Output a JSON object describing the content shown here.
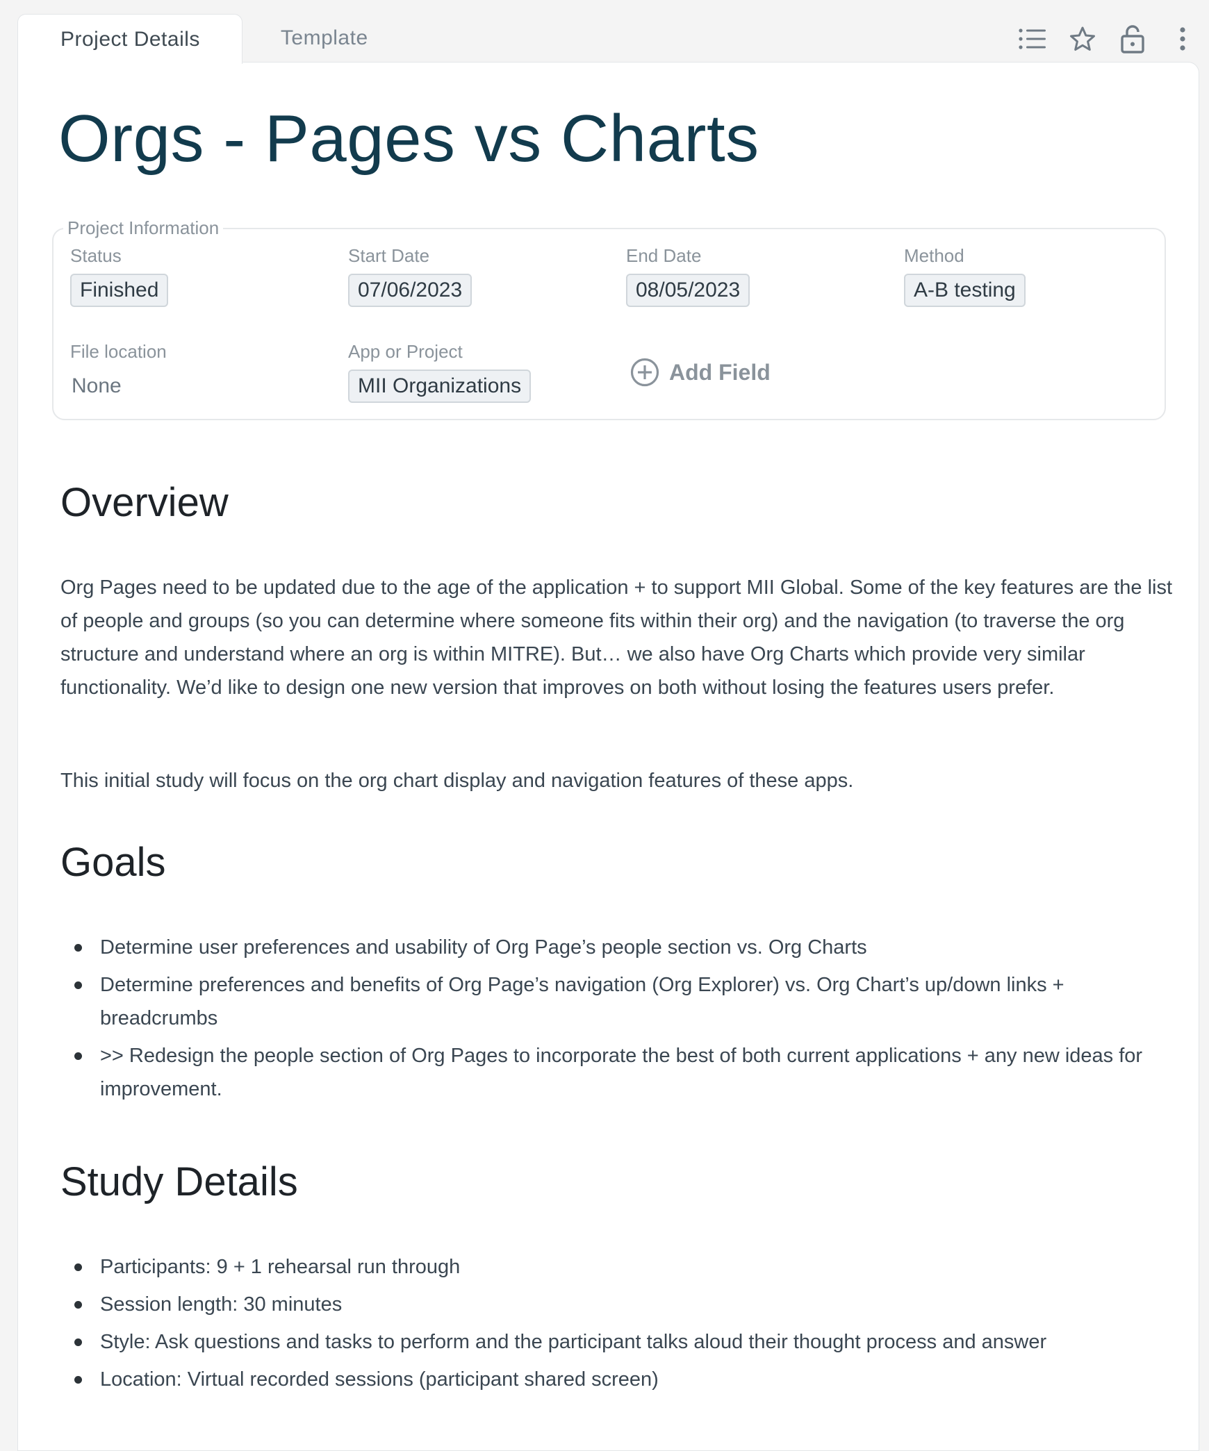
{
  "tabs": [
    {
      "label": "Project Details",
      "active": true
    },
    {
      "label": "Template",
      "active": false
    }
  ],
  "toolbar": {
    "icons": [
      "list-icon",
      "star-icon",
      "lock-icon",
      "more-vertical-icon"
    ]
  },
  "page": {
    "title": "Orgs - Pages vs Charts"
  },
  "project_info": {
    "legend": "Project Information",
    "status": {
      "label": "Status",
      "value": "Finished"
    },
    "start_date": {
      "label": "Start Date",
      "value": "07/06/2023"
    },
    "end_date": {
      "label": "End Date",
      "value": "08/05/2023"
    },
    "method": {
      "label": "Method",
      "value": "A-B testing"
    },
    "file_location": {
      "label": "File location",
      "value": "None"
    },
    "app_or_project": {
      "label": "App or Project",
      "value": "MII Organizations"
    },
    "add_field_label": "Add Field"
  },
  "overview": {
    "heading": "Overview",
    "paragraphs": [
      "Org Pages need to be updated due to the age of the application + to support MII Global.  Some of the key features are the list of people and groups  (so you can determine where someone fits within their org) and the navigation  (to traverse the org structure and understand where an org is within MITRE).  But… we also have Org Charts which provide very similar functionality.  We’d like to design one new version that improves on both without losing the features users prefer.",
      "This initial study will focus on the org chart display and navigation features of these apps."
    ]
  },
  "goals": {
    "heading": "Goals",
    "items": [
      "Determine user preferences and usability of Org Page’s people section vs. Org Charts",
      "Determine preferences and benefits of Org Page’s navigation (Org Explorer) vs. Org Chart’s up/down links + breadcrumbs",
      ">> Redesign the people section of Org Pages to incorporate the best of both current applications + any new ideas for improvement."
    ]
  },
  "study_details": {
    "heading": "Study Details",
    "items": [
      "Participants: 9 + 1 rehearsal run through",
      "Session length: 30 minutes",
      "Style: Ask questions and tasks to perform and the participant talks aloud their thought process and answer",
      "Location: Virtual recorded sessions (participant shared screen)"
    ]
  },
  "colors": {
    "title": "#123b4d",
    "chip_bg": "#eef1f4",
    "chip_border": "#d0d6db",
    "muted": "#8a939b"
  }
}
